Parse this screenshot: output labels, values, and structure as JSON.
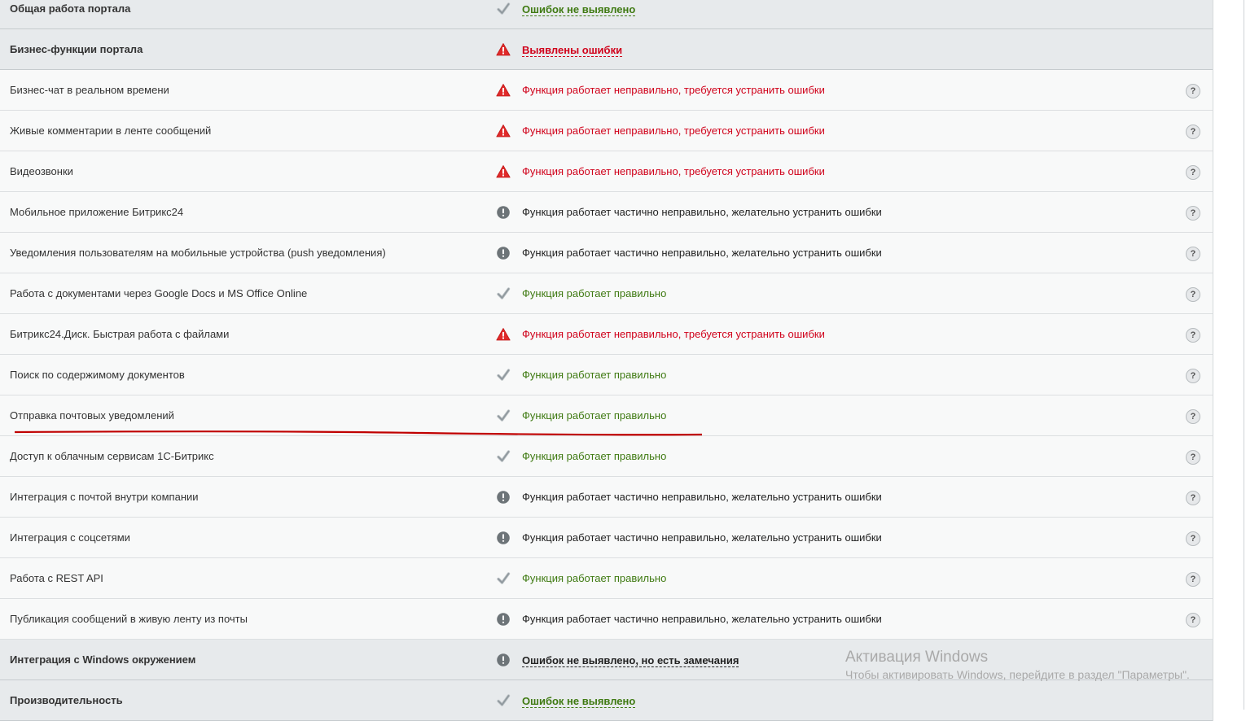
{
  "rows": [
    {
      "name": "Общая работа портала",
      "kind": "section",
      "status": "ok",
      "text": "Ошибок не выявлено"
    },
    {
      "name": "Бизнес-функции портала",
      "kind": "section",
      "status": "err",
      "text": "Выявлены ошибки"
    },
    {
      "name": "Бизнес-чат в реальном времени",
      "kind": "item",
      "status": "err",
      "text": "Функция работает неправильно, требуется устранить ошибки"
    },
    {
      "name": "Живые комментарии в ленте сообщений",
      "kind": "item",
      "status": "err",
      "text": "Функция работает неправильно, требуется устранить ошибки"
    },
    {
      "name": "Видеозвонки",
      "kind": "item",
      "status": "err",
      "text": "Функция работает неправильно, требуется устранить ошибки"
    },
    {
      "name": "Мобильное приложение Битрикс24",
      "kind": "item",
      "status": "warn",
      "text": "Функция работает частично неправильно, желательно устранить ошибки"
    },
    {
      "name": "Уведомления пользователям на мобильные устройства (push уведомления)",
      "kind": "item",
      "status": "warn",
      "text": "Функция работает частично неправильно, желательно устранить ошибки"
    },
    {
      "name": "Работа с документами через Google Docs и MS Office Online",
      "kind": "item",
      "status": "ok",
      "text": "Функция работает правильно"
    },
    {
      "name": "Битрикс24.Диск. Быстрая работа с файлами",
      "kind": "item",
      "status": "err",
      "text": "Функция работает неправильно, требуется устранить ошибки"
    },
    {
      "name": "Поиск по содержимому документов",
      "kind": "item",
      "status": "ok",
      "text": "Функция работает правильно"
    },
    {
      "name": "Отправка почтовых уведомлений",
      "kind": "item",
      "status": "ok",
      "text": "Функция работает правильно"
    },
    {
      "name": "Доступ к облачным сервисам 1С-Битрикс",
      "kind": "item",
      "status": "ok",
      "text": "Функция работает правильно"
    },
    {
      "name": "Интеграция с почтой внутри компании",
      "kind": "item",
      "status": "warn",
      "text": "Функция работает частично неправильно, желательно устранить ошибки"
    },
    {
      "name": "Интеграция с соцсетями",
      "kind": "item",
      "status": "warn",
      "text": "Функция работает частично неправильно, желательно устранить ошибки"
    },
    {
      "name": "Работа с REST API",
      "kind": "item",
      "status": "ok",
      "text": "Функция работает правильно"
    },
    {
      "name": "Публикация сообщений в живую ленту из почты",
      "kind": "item",
      "status": "warn",
      "text": "Функция работает частично неправильно, желательно устранить ошибки"
    },
    {
      "name": "Интеграция с Windows окружением",
      "kind": "section",
      "status": "warn",
      "text": "Ошибок не выявлено, но есть замечания"
    },
    {
      "name": "Производительность",
      "kind": "section",
      "status": "ok",
      "text": "Ошибок не выявлено"
    }
  ],
  "help_label": "?",
  "watermark": {
    "title": "Активация Windows",
    "subtitle": "Чтобы активировать Windows, перейдите в раздел \"Параметры\"."
  },
  "colors": {
    "ok": "#3f7a12",
    "err": "#d0021b",
    "warn": "#222222",
    "annotation": "#c00000"
  },
  "icons": {
    "ok": "check-icon",
    "err": "error-triangle-icon",
    "warn": "exclamation-circle-icon",
    "help": "help-icon"
  }
}
